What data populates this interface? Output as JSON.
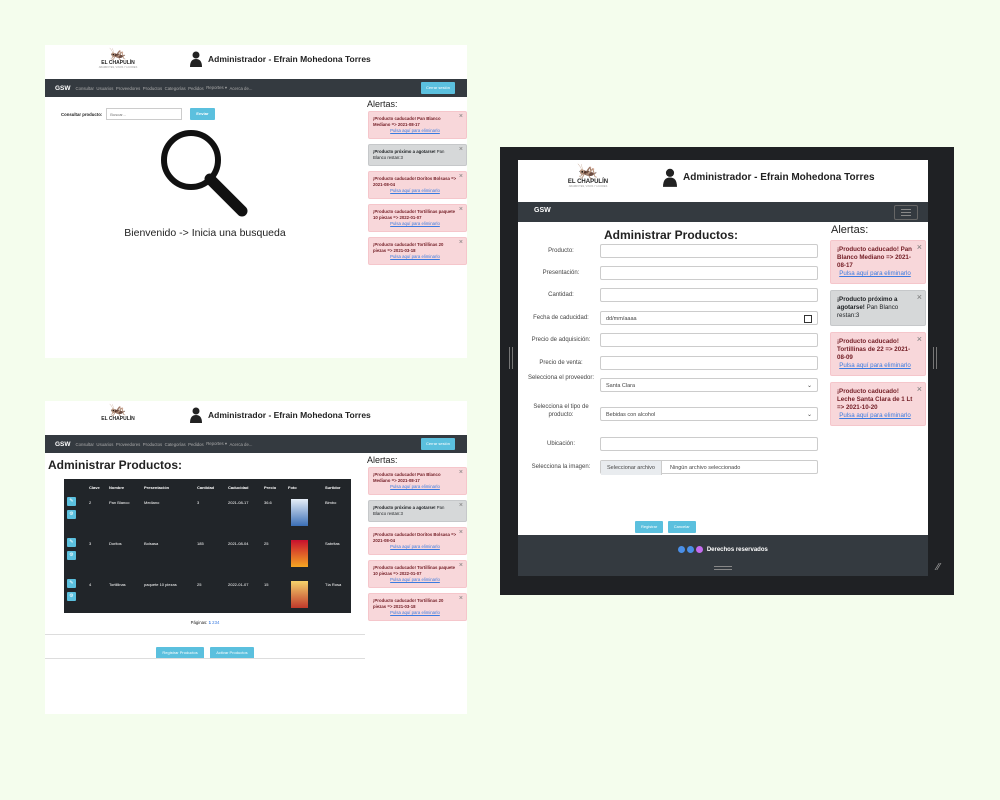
{
  "app": {
    "logo_brand": "EL CHAPULÍN",
    "logo_tagline": "ABARROTES, VINOS Y LICORES",
    "admin_title": "Administrador - Efrain Mohedona Torres",
    "nav_brand": "GSW",
    "nav_items": [
      "Consultar",
      "Usuarios",
      "Proveedores",
      "Productos",
      "Categorías",
      "Pedidos",
      "Reportes ▾",
      "Acerca de..."
    ],
    "logout": "Cerrar sesión",
    "alerts_title": "Alertas:"
  },
  "colors": {
    "page_bg": "#f4fded",
    "navbar": "#343a40",
    "accent": "#5bc0de",
    "alert_red": "#f8d7da",
    "alert_grey": "#d6d8d9"
  },
  "alerts": [
    {
      "type": "red",
      "title": "¡Producto caducado! Pan Blanco Mediano => 2021-08-17",
      "extra": "",
      "link": "Pulsa aquí para eliminarlo"
    },
    {
      "type": "grey",
      "title": "¡Producto próximo a agotarse!",
      "extra": "Pan Blanco restan:3",
      "link": ""
    },
    {
      "type": "red",
      "title": "¡Producto caducado! Doritos Bolsasa => 2021-08-04",
      "extra": "",
      "link": "Pulsa aquí para eliminarlo"
    },
    {
      "type": "red",
      "title": "¡Producto caducado! Tortillinas paquete 10 piezas => 2022-01-07",
      "extra": "",
      "link": "Pulsa aquí para eliminarlo"
    },
    {
      "type": "red",
      "title": "¡Producto caducado! Tortillinas 20 piezas => 2021-03-18",
      "extra": "",
      "link": "Pulsa aquí para eliminarlo"
    }
  ],
  "search": {
    "label": "Consultar producto:",
    "placeholder": "Buscar...",
    "button": "Enviar",
    "welcome": "Bienvenido -> Inicia una busqueda"
  },
  "products_page": {
    "title": "Administrar Productos:",
    "columns": [
      "Clave",
      "Nombre",
      "Presentación",
      "Cantidad",
      "Caducidad",
      "Precio",
      "Foto",
      "Surtidor"
    ],
    "rows": [
      [
        "2",
        "Pan Blanco",
        "Mediano",
        "3",
        "2021-08-17",
        "36.6",
        "",
        "Bimbo"
      ],
      [
        "3",
        "Doritos",
        "Bolsasa",
        "185",
        "2021-08-04",
        "25",
        "",
        "Sabritas"
      ],
      [
        "4",
        "Tortillinas",
        "paquete 10 piezas",
        "25",
        "2022-01-07",
        "15",
        "",
        "Tía Rosa"
      ]
    ],
    "pages_label": "Páginas:",
    "pages": [
      "1",
      "2",
      "3",
      "4"
    ],
    "btn_register": "Registrar Productos",
    "btn_activate": "Activar Productos"
  },
  "form": {
    "title": "Administrar Productos:",
    "fields": [
      {
        "label": "Producto:",
        "value": ""
      },
      {
        "label": "Presentación:",
        "value": ""
      },
      {
        "label": "Cantidad:",
        "value": ""
      },
      {
        "label": "Fecha de caducidad:",
        "value": "dd/mm/aaaa"
      },
      {
        "label": "Precio de adquisición:",
        "value": ""
      },
      {
        "label": "Precio de venta:",
        "value": ""
      },
      {
        "label": "Selecciona el proveedor:",
        "value": "Santa Clara"
      },
      {
        "label": "Selecciona el tipo de producto:",
        "value": "Bebidas con alcohol"
      },
      {
        "label": "Ubicación:",
        "value": ""
      },
      {
        "label": "Selecciona la imagen:",
        "value": "Ningún archivo seleccionado"
      }
    ],
    "file_button": "Seleccionar archivo",
    "btn_register": "Registrar",
    "btn_cancel": "Cancelar"
  },
  "alerts3": [
    {
      "type": "red",
      "title": "¡Producto caducado! Pan Blanco Mediano => 2021-08-17",
      "extra": "",
      "link": "Pulsa aquí para eliminarlo"
    },
    {
      "type": "grey",
      "title": "¡Producto próximo a agotarse!",
      "extra": "Pan Blanco restan:3",
      "link": ""
    },
    {
      "type": "red",
      "title": "¡Producto caducado! Tortillinas de 22 => 2021-08-09",
      "extra": "",
      "link": "Pulsa aquí para eliminarlo"
    },
    {
      "type": "red",
      "title": "¡Producto caducado! Leche Santa Clara de 1 Lt => 2021-10-20",
      "extra": "",
      "link": "Pulsa aquí para eliminarlo"
    }
  ],
  "footer": {
    "text": "Derechos reservados",
    "icons": [
      "facebook-icon",
      "twitter-icon",
      "instagram-icon"
    ]
  }
}
